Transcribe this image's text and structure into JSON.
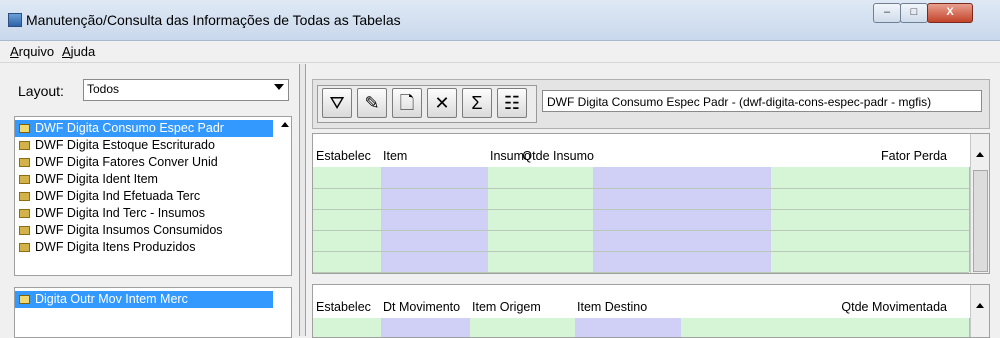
{
  "window": {
    "title": "Manutenção/Consulta das Informações de Todas as Tabelas",
    "controls": {
      "minimize": "–",
      "maximize": "□",
      "close": "X"
    }
  },
  "menu": {
    "items": [
      "Arquivo",
      "Ajuda"
    ]
  },
  "sidebar": {
    "layout_label": "Layout:",
    "layout_value": "Todos",
    "tables": [
      "DWF Digita Consumo Espec Padr",
      "DWF Digita Estoque Escriturado",
      "DWF Digita Fatores Conver Unid",
      "DWF Digita Ident Item",
      "DWF Digita Ind Efetuada Terc",
      "DWF Digita Ind Terc - Insumos",
      "DWF Digita Insumos Consumidos",
      "DWF Digita Itens Produzidos"
    ],
    "selected_index": 0,
    "children": [
      "Digita Outr Mov Intem Merc"
    ]
  },
  "toolbar": {
    "icons": [
      "filter-icon",
      "edit-icon",
      "new-document-icon",
      "excel-icon",
      "sum-icon",
      "properties-icon"
    ],
    "glyphs": [
      "⛛",
      "✎",
      "🗋",
      "✕",
      "Σ",
      "☷"
    ],
    "title": "DWF Digita Consumo Espec Padr - (dwf-digita-cons-espec-padr - mgfis)"
  },
  "grid1": {
    "columns": [
      "Estabelec",
      "Item",
      "Insumo",
      "Qtde Insumo",
      "Fator Perda"
    ],
    "column_colors": [
      "#d6f5d6",
      "#d0d0f7",
      "#d6f5d6",
      "#d0d0f7",
      "#d6f5d6"
    ]
  },
  "grid2": {
    "columns": [
      "Estabelec",
      "Dt Movimento",
      "Item Origem",
      "Item Destino",
      "Qtde Movimentada"
    ],
    "column_colors": [
      "#d6f5d6",
      "#d0d0f7",
      "#d6f5d6",
      "#d0d0f7",
      "#d6f5d6"
    ]
  }
}
